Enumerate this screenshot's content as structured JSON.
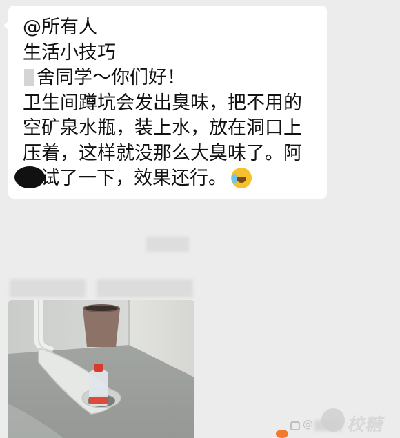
{
  "message": {
    "mention": "@所有人",
    "title": "生活小技巧",
    "greeting": "舍同学～你们好！",
    "body_line1": "卫生间蹲坑会发出臭味，把不用的",
    "body_line2": "空矿泉水瓶，装上水，放在洞口上",
    "body_line3": "压着，这样就没那么大臭味了。阿",
    "body_line4": "试了一下，效果还行。",
    "emoji": "crying-laughing-emoji"
  },
  "watermark": {
    "at_symbol": "@",
    "brand": "校糖"
  },
  "colors": {
    "chat_background": "#ececec",
    "bubble": "#ffffff",
    "text": "#111111"
  }
}
